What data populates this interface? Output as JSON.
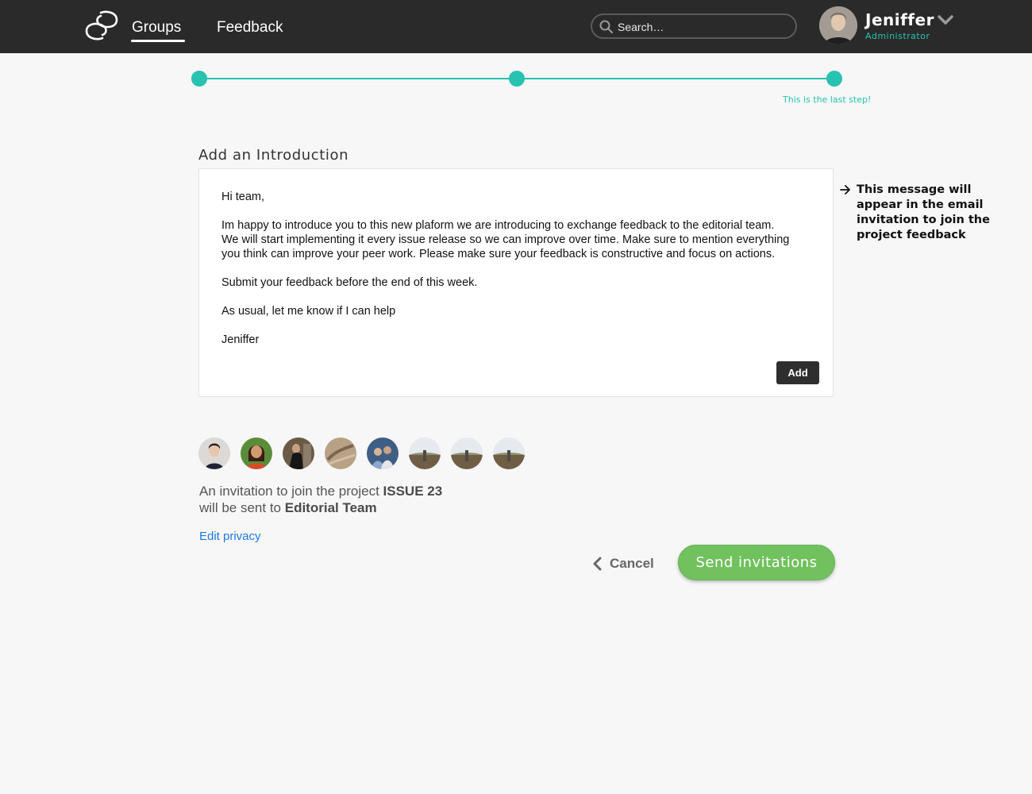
{
  "header": {
    "nav": [
      {
        "label": "Groups",
        "active": true
      },
      {
        "label": "Feedback",
        "active": false
      }
    ],
    "search": {
      "placeholder": "Search…",
      "value": ""
    },
    "user": {
      "name": "Jeniffer",
      "role": "Administrator"
    },
    "icons": {
      "logo": "link-logo-icon",
      "search": "search-icon",
      "menu": "chevron-down-icon"
    }
  },
  "stepper": {
    "steps": 3,
    "current": 3,
    "note": "This is the last step!",
    "color": "#27c2b0"
  },
  "intro": {
    "title": "Add an Introduction",
    "paragraphs": [
      "Hi team,",
      "Im happy to introduce you to this new plaform we are introducing to exchange feedback to the editorial team. We will start implementing it every issue release so we can improve over time. Make sure to mention everything you think can improve your peer work. Please make sure your feedback is constructive and focus on actions.",
      "Submit your feedback before the end of this week.",
      "As usual, let me know if I can help",
      "Jeniffer"
    ],
    "add_label": "Add",
    "side_note": "This message will appear in the email invitation to join the project feedback"
  },
  "recipients": {
    "avatar_count": 8,
    "invite_line1_prefix": "An invitation to join the project ",
    "project": "ISSUE 23",
    "invite_line2_prefix": "will be sent to ",
    "team": "Editorial Team",
    "edit_privacy": "Edit privacy"
  },
  "actions": {
    "cancel": "Cancel",
    "send": "Send invitations",
    "send_color": "#72c15f"
  }
}
